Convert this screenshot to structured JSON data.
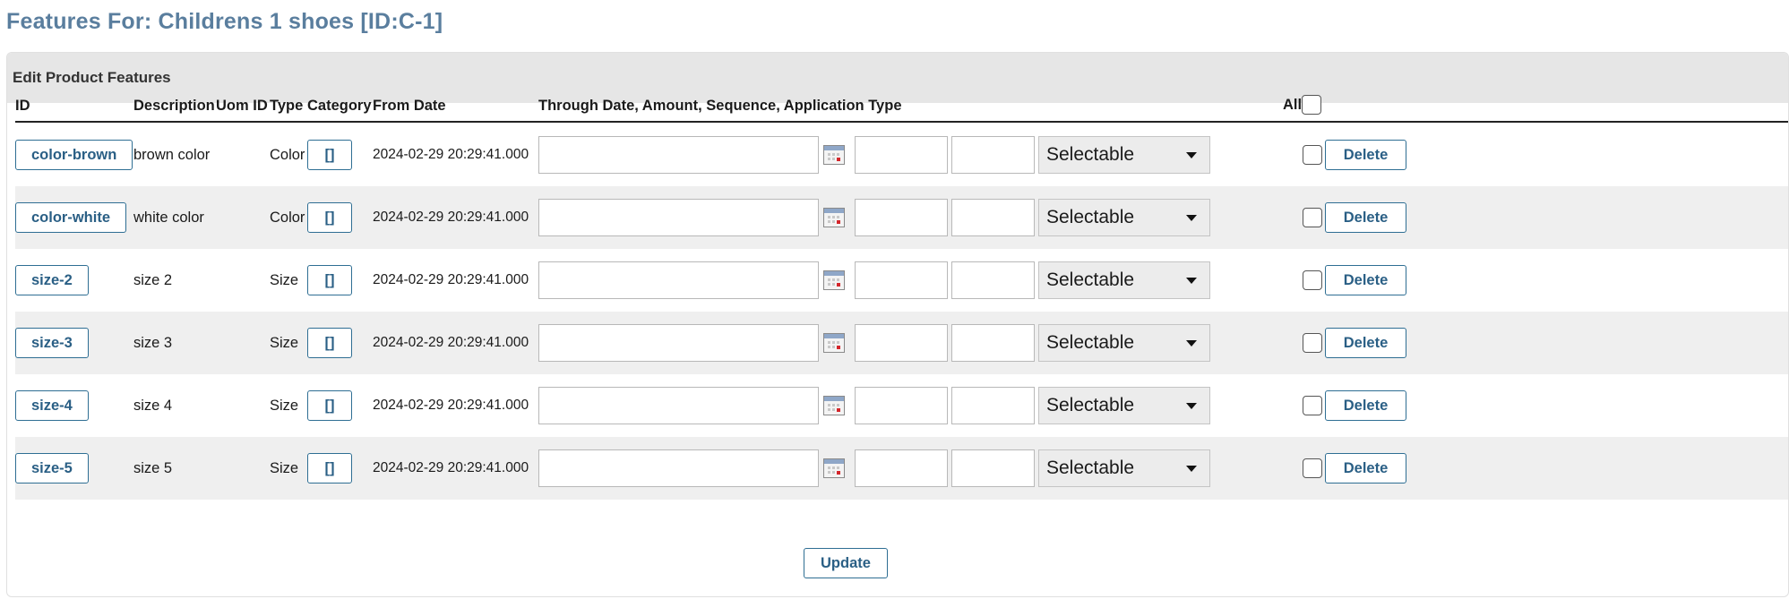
{
  "page": {
    "title": "Features For: Childrens 1 shoes [ID:C-1]"
  },
  "panel": {
    "title": "Edit Product Features"
  },
  "columns": {
    "id": "ID",
    "description": "Description",
    "uom_id": "Uom ID",
    "type": "Type",
    "category": "Category",
    "from_date": "From Date",
    "through": "Through Date, Amount, Sequence, Application Type",
    "all": "All"
  },
  "rows": [
    {
      "id": "color-brown",
      "description": "brown color",
      "uom_id": "",
      "type": "Color",
      "category": "[]",
      "from_date": "2024-02-29 20:29:41.000",
      "through_date": "",
      "amount": "",
      "sequence": "",
      "application_type": "Selectable",
      "delete_label": "Delete"
    },
    {
      "id": "color-white",
      "description": "white color",
      "uom_id": "",
      "type": "Color",
      "category": "[]",
      "from_date": "2024-02-29 20:29:41.000",
      "through_date": "",
      "amount": "",
      "sequence": "",
      "application_type": "Selectable",
      "delete_label": "Delete"
    },
    {
      "id": "size-2",
      "description": "size 2",
      "uom_id": "",
      "type": "Size",
      "category": "[]",
      "from_date": "2024-02-29 20:29:41.000",
      "through_date": "",
      "amount": "",
      "sequence": "",
      "application_type": "Selectable",
      "delete_label": "Delete"
    },
    {
      "id": "size-3",
      "description": "size 3",
      "uom_id": "",
      "type": "Size",
      "category": "[]",
      "from_date": "2024-02-29 20:29:41.000",
      "through_date": "",
      "amount": "",
      "sequence": "",
      "application_type": "Selectable",
      "delete_label": "Delete"
    },
    {
      "id": "size-4",
      "description": "size 4",
      "uom_id": "",
      "type": "Size",
      "category": "[]",
      "from_date": "2024-02-29 20:29:41.000",
      "through_date": "",
      "amount": "",
      "sequence": "",
      "application_type": "Selectable",
      "delete_label": "Delete"
    },
    {
      "id": "size-5",
      "description": "size 5",
      "uom_id": "",
      "type": "Size",
      "category": "[]",
      "from_date": "2024-02-29 20:29:41.000",
      "through_date": "",
      "amount": "",
      "sequence": "",
      "application_type": "Selectable",
      "delete_label": "Delete"
    }
  ],
  "actions": {
    "update_label": "Update"
  },
  "icons": {
    "calendar": "calendar-icon",
    "select_caret": "chevron-down-icon"
  },
  "colors": {
    "title": "#5a7e9e",
    "button_border": "#2e6e93",
    "button_text": "#2a5f85",
    "row_alt": "#efefef",
    "panel_header": "#e6e6e6"
  }
}
